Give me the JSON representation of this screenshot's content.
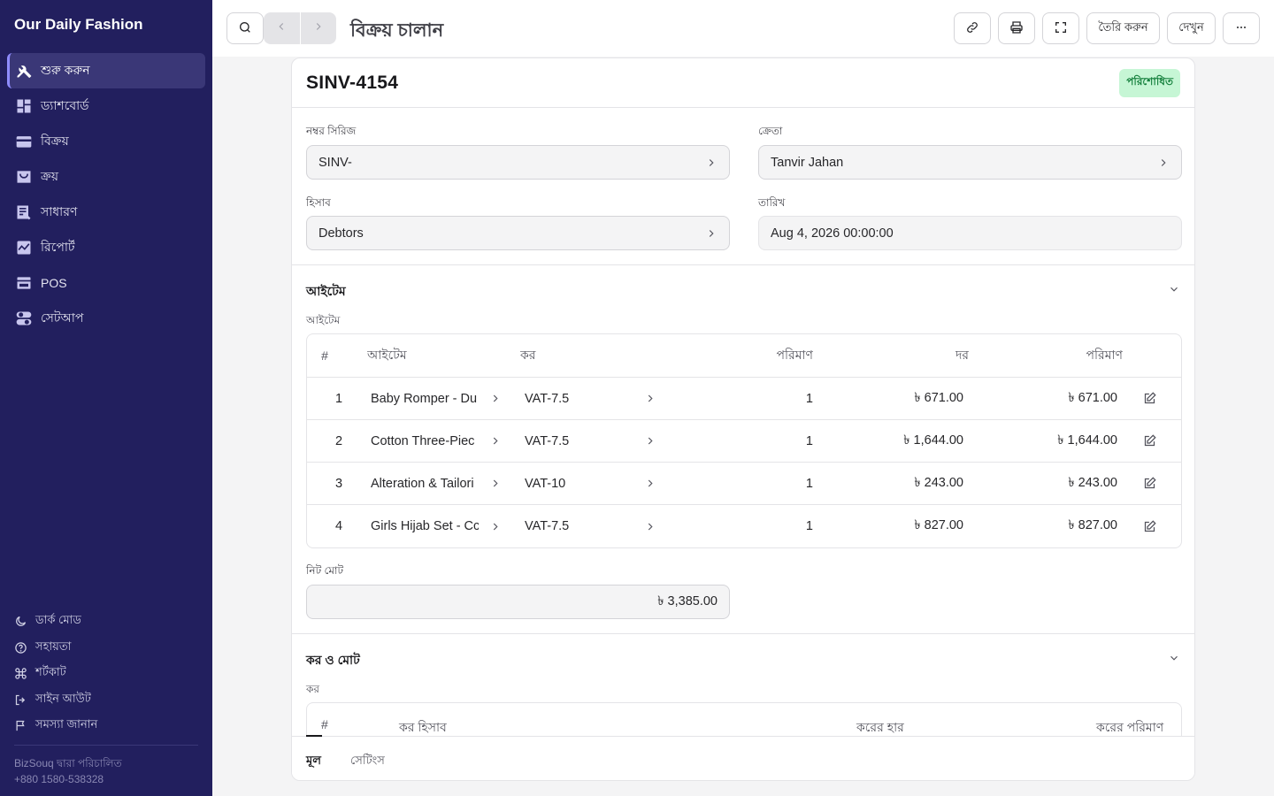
{
  "sidebar": {
    "brand": "Our Daily Fashion",
    "items": [
      {
        "label": "শুরু করুন",
        "icon": "tools-icon"
      },
      {
        "label": "ড্যাশবোর্ড",
        "icon": "dashboard-icon"
      },
      {
        "label": "বিক্রয়",
        "icon": "sales-icon"
      },
      {
        "label": "ক্রয়",
        "icon": "purchase-icon"
      },
      {
        "label": "সাধারণ",
        "icon": "common-icon"
      },
      {
        "label": "রিপোর্ট",
        "icon": "report-icon"
      },
      {
        "label": "POS",
        "icon": "pos-icon"
      },
      {
        "label": "সেটআপ",
        "icon": "setup-icon"
      }
    ],
    "bottom_links": [
      {
        "label": "ডার্ক মোড",
        "icon": "moon-icon"
      },
      {
        "label": "সহায়তা",
        "icon": "help-icon"
      },
      {
        "label": "শর্টকাট",
        "icon": "command-icon"
      },
      {
        "label": "সাইন আউট",
        "icon": "sign-out-icon"
      },
      {
        "label": "সমস্যা জানান",
        "icon": "flag-icon"
      }
    ],
    "footer_line1": "BizSouq দ্বারা পরিচালিত",
    "footer_line2": "+880 1580-538328"
  },
  "topbar": {
    "title": "বিক্রয় চালান",
    "create_label": "তৈরি করুন",
    "view_label": "দেখুন"
  },
  "invoice": {
    "id": "SINV-4154",
    "status": "পরিশোধিত",
    "fields": {
      "series_label": "নম্বর সিরিজ",
      "series_value": "SINV-",
      "customer_label": "ক্রেতা",
      "customer_value": "Tanvir Jahan",
      "account_label": "হিসাব",
      "account_value": "Debtors",
      "date_label": "তারিখ",
      "date_value": "Aug 4, 2026 00:00:00"
    },
    "items_section": {
      "title": "আইটেম",
      "sublabel": "আইটেম",
      "headers": {
        "idx": "#",
        "item": "আইটেম",
        "tax": "কর",
        "qty": "পরিমাণ",
        "rate": "দর",
        "amount": "পরিমাণ"
      },
      "rows": [
        {
          "idx": "1",
          "item": "Baby Romper - Du",
          "tax": "VAT-7.5",
          "qty": "1",
          "rate": "৳ 671.00",
          "amount": "৳ 671.00"
        },
        {
          "idx": "2",
          "item": "Cotton Three-Piec",
          "tax": "VAT-7.5",
          "qty": "1",
          "rate": "৳ 1,644.00",
          "amount": "৳ 1,644.00"
        },
        {
          "idx": "3",
          "item": "Alteration & Tailori",
          "tax": "VAT-10",
          "qty": "1",
          "rate": "৳ 243.00",
          "amount": "৳ 243.00"
        },
        {
          "idx": "4",
          "item": "Girls Hijab Set - Cc",
          "tax": "VAT-7.5",
          "qty": "1",
          "rate": "৳ 827.00",
          "amount": "৳ 827.00"
        }
      ],
      "net_total_label": "নিট মোট",
      "net_total_value": "৳ 3,385.00"
    },
    "tax_section": {
      "title": "কর ও মোট",
      "sublabel": "কর",
      "headers": {
        "idx": "#",
        "account": "কর হিসাব",
        "rate": "করের হার",
        "amount": "করের পরিমাণ"
      }
    },
    "tabs": [
      "মূল",
      "সেটিংস"
    ]
  }
}
